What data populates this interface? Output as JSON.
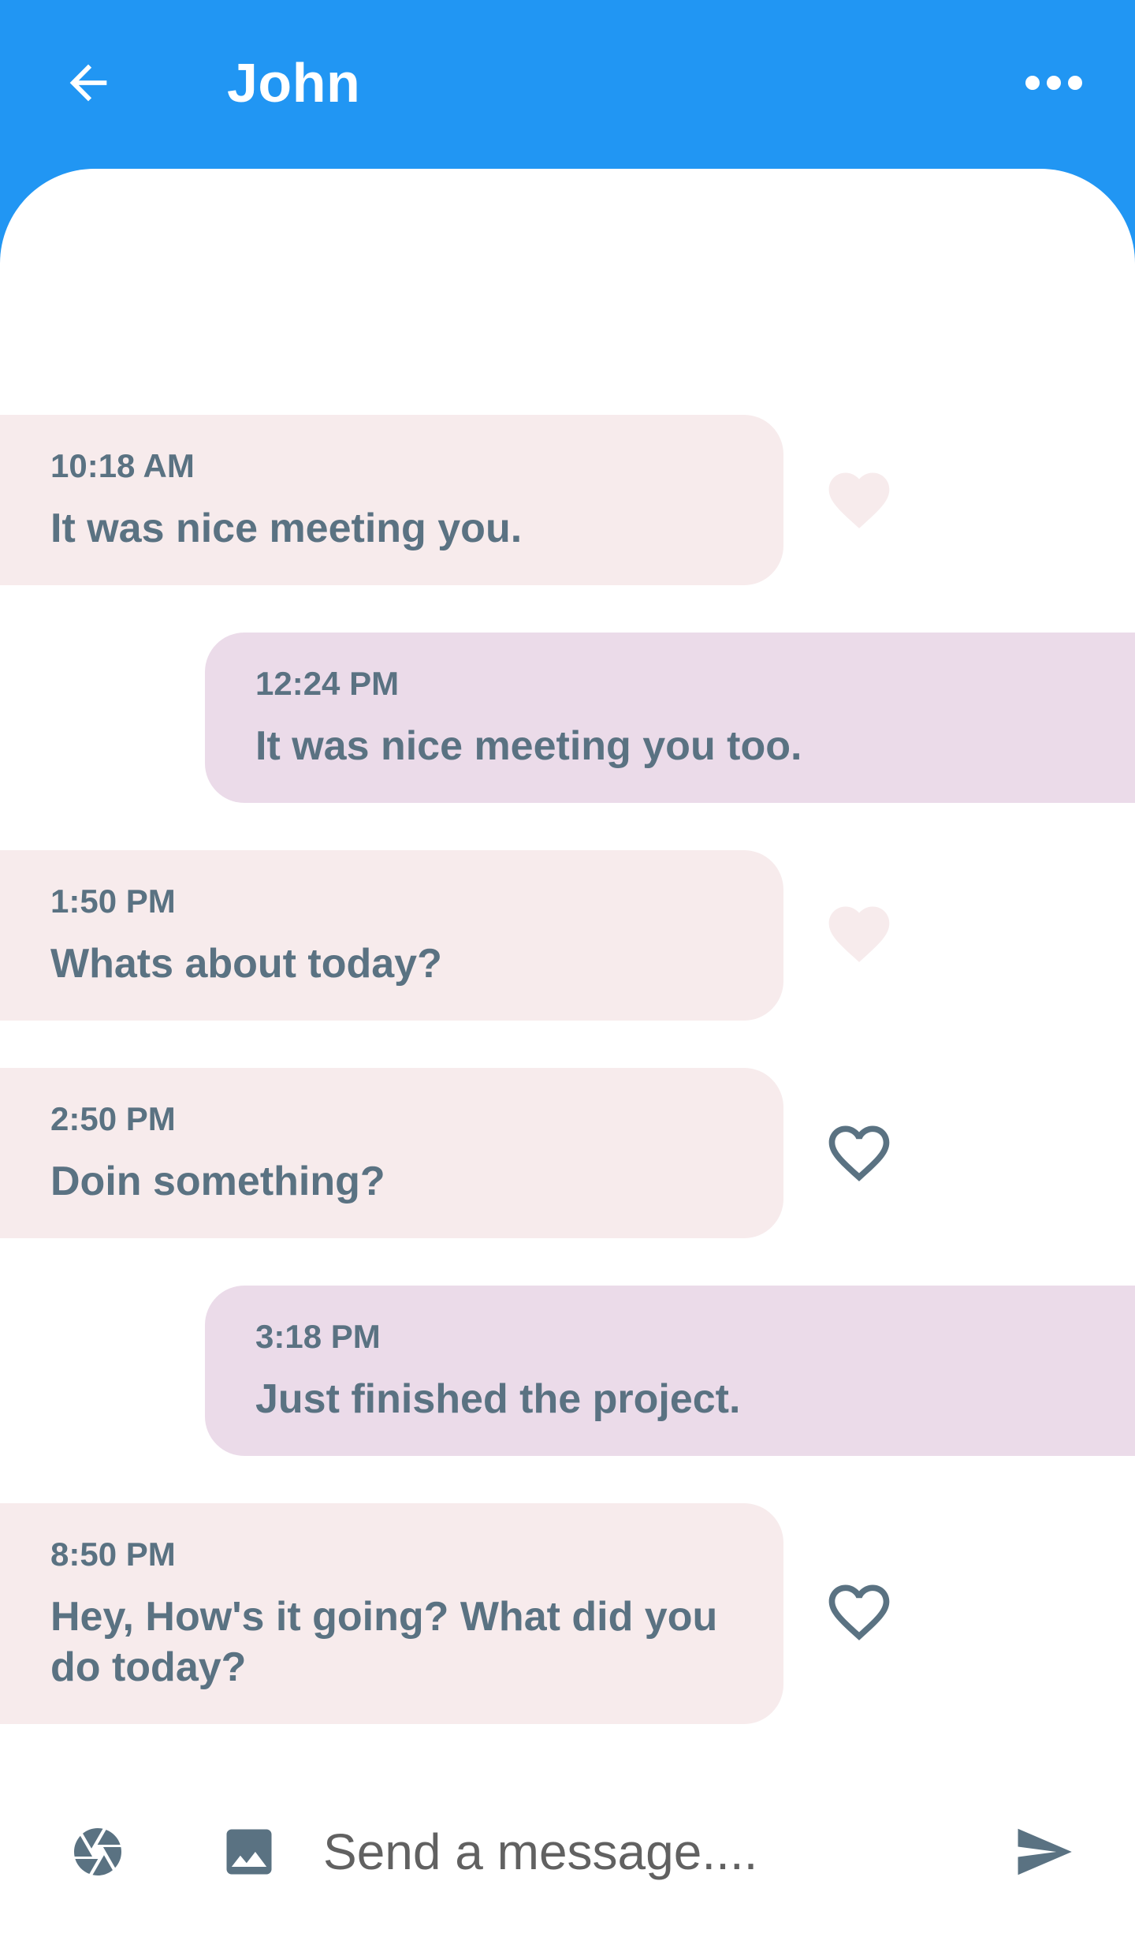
{
  "header": {
    "title": "John",
    "back_icon": "arrow-left-icon",
    "more_icon": "more-horizontal-icon",
    "background": "#2196F3"
  },
  "messages": [
    {
      "direction": "incoming",
      "time": "10:18 AM",
      "text": "It was nice meeting you.",
      "liked": true
    },
    {
      "direction": "outgoing",
      "time": "12:24 PM",
      "text": "It was nice meeting you too."
    },
    {
      "direction": "incoming",
      "time": "1:50 PM",
      "text": "Whats about today?",
      "liked": true
    },
    {
      "direction": "incoming",
      "time": "2:50 PM",
      "text": "Doin something?",
      "liked": false
    },
    {
      "direction": "outgoing",
      "time": "3:18 PM",
      "text": "Just finished the project."
    },
    {
      "direction": "incoming",
      "time": "8:50 PM",
      "text": "Hey, How's it going? What did you do today?",
      "liked": false
    }
  ],
  "composer": {
    "placeholder": "Send a message....",
    "camera_icon": "camera-shutter-icon",
    "image_icon": "image-icon",
    "send_icon": "send-icon"
  },
  "colors": {
    "incoming_bubble": "#F7EBEC",
    "outgoing_bubble": "#EBDBE9",
    "text": "#5A7282",
    "heart_liked": "#F7EBEC",
    "heart_outline": "#5A7282"
  }
}
